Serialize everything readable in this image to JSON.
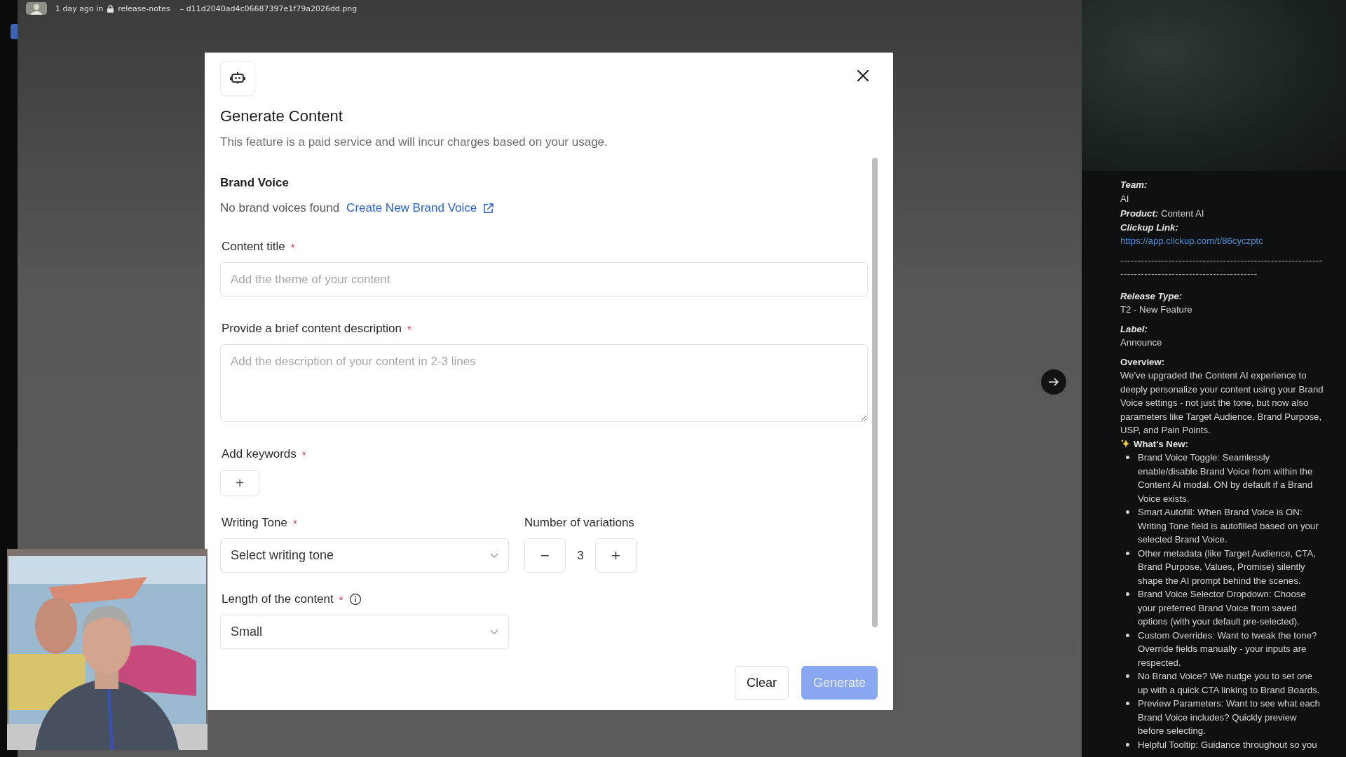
{
  "top_bar": {
    "time": "1 day ago in",
    "channel": "release-notes",
    "filename": "– d11d2040ad4c06687397e1f79a2026dd.png"
  },
  "modal": {
    "title": "Generate Content",
    "subtitle": "This feature is a paid service and will incur charges based on your usage.",
    "brand_voice": {
      "heading": "Brand Voice",
      "empty_text": "No brand voices found",
      "link": "Create New Brand Voice"
    },
    "fields": [
      {
        "kind": "text",
        "label": "Content title",
        "required_mark": "*",
        "placeholder": "Add the theme of your content"
      },
      {
        "kind": "textarea",
        "label": "Provide a brief content description",
        "required_mark": "*",
        "placeholder": "Add the description of your content in 2-3 lines"
      },
      {
        "kind": "keywords",
        "label": "Add keywords",
        "required_mark": "*",
        "add": "+"
      }
    ],
    "writing_tone": {
      "label": "Writing Tone",
      "required_mark": "*",
      "placeholder": "Select writing tone"
    },
    "variations": {
      "label": "Number of variations",
      "minus": "−",
      "value": "3",
      "plus": "+"
    },
    "length": {
      "label": "Length of the content",
      "required_mark": "*",
      "value": "Small"
    },
    "buttons": [
      {
        "label": "Clear",
        "kind": "secondary",
        "disabled": false
      },
      {
        "label": "Generate",
        "kind": "primary",
        "disabled": true
      }
    ]
  },
  "release_notes": [
    {
      "kind": "stacked",
      "label": "Team:",
      "value": "AI"
    },
    {
      "kind": "inline",
      "label": "Product:",
      "value": "Content AI"
    },
    {
      "kind": "link",
      "label": "Clickup Link:",
      "value": "https://app.clickup.com/t/86cyczptc"
    },
    {
      "kind": "divider",
      "value": "---------------------------------------------------------------------------------------------------"
    },
    {
      "kind": "stacked",
      "label": "Release Type:",
      "value": "T2 - New Feature"
    },
    {
      "kind": "stacked",
      "label": "Label:",
      "value": "Announce"
    },
    {
      "kind": "heading",
      "label": "Overview:",
      "value": "We've upgraded the Content AI experience to deeply personalize your content using your Brand Voice settings - not just the tone, but now also parameters like Target Audience, Brand Purpose, USP, and Pain Points."
    },
    {
      "kind": "bullets",
      "label": "What's New:",
      "items": [
        "Brand Voice Toggle: Seamlessly enable/disable Brand Voice from within the Content AI modal. ON by default if a Brand Voice exists.",
        "Smart Autofill: When Brand Voice is ON: Writing Tone field is autofilled based on your selected Brand Voice.",
        "Other metadata (like Target Audience, CTA, Brand Purpose, Values, Promise) silently shape the AI prompt behind the scenes.",
        "Brand Voice Selector Dropdown: Choose your preferred Brand Voice from saved options (with your default pre-selected).",
        "Custom Overrides: Want to tweak the tone? Override fields manually - your inputs are respected.",
        "No Brand Voice? We nudge you to set one up with a quick CTA linking to Brand Boards.",
        "Preview Parameters: Want to see what each Brand Voice includes? Quickly preview before selecting.",
        "Helpful Tooltip: Guidance throughout so you"
      ]
    }
  ]
}
